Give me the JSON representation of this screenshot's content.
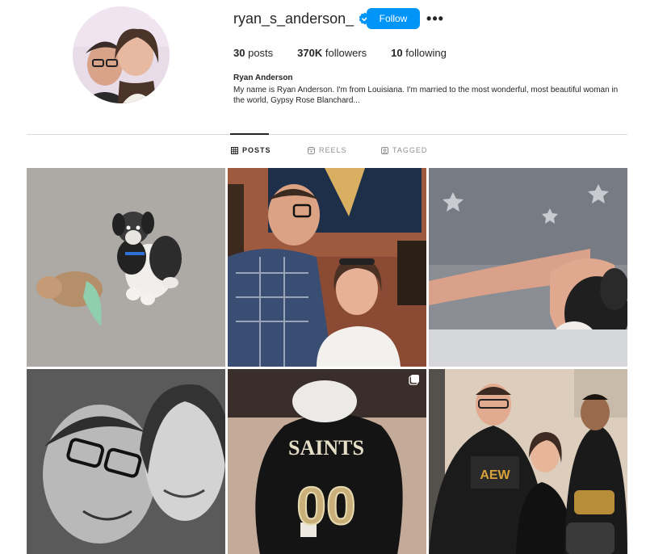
{
  "profile": {
    "username": "ryan_s_anderson_",
    "verified_icon": "verified-badge-icon",
    "follow_label": "Follow",
    "more_label": "•••",
    "stats": {
      "posts_count": "30",
      "posts_label": "posts",
      "followers_count": "370K",
      "followers_label": "followers",
      "following_count": "10",
      "following_label": "following"
    },
    "display_name": "Ryan Anderson",
    "bio": "My name is Ryan Anderson. I'm from Louisiana. I'm married to the most wonderful, most beautiful woman in the world, Gypsy Rose Blanchard..."
  },
  "tabs": [
    {
      "label": "POSTS",
      "icon": "grid-icon",
      "active": true
    },
    {
      "label": "REELS",
      "icon": "reels-icon",
      "active": false
    },
    {
      "label": "TAGGED",
      "icon": "tagged-icon",
      "active": false
    }
  ],
  "posts": [
    {
      "subject": "puppy-on-carpet"
    },
    {
      "subject": "couple-selfie-restaurant"
    },
    {
      "subject": "puppy-on-lap"
    },
    {
      "subject": "couple-selfie-bw"
    },
    {
      "subject": "dog-in-saints-jersey",
      "multi_icon": "carousel-icon"
    },
    {
      "subject": "group-photo-wrestling"
    }
  ],
  "jersey_text": {
    "team": "SAINTS",
    "number": "00"
  },
  "shirt_logo_text": "AEW",
  "colors": {
    "accent": "#0095f6",
    "text": "#262626",
    "muted": "#8e8e8e",
    "divider": "#dbdbdb"
  }
}
